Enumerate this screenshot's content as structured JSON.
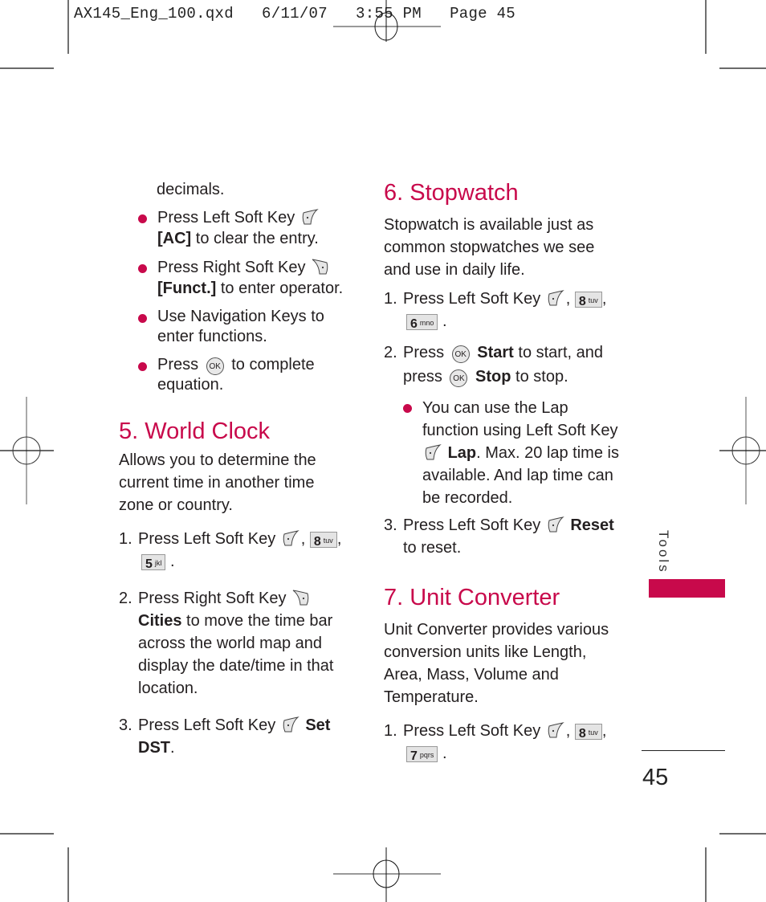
{
  "slug": "AX145_Eng_100.qxd   6/11/07   3:55 PM   Page 45",
  "left_column": {
    "continued_text": "decimals.",
    "bullets": [
      {
        "pre": "Press Left Soft Key",
        "icon": "left-soft-key",
        "bold": "[AC]",
        "post": " to clear the entry."
      },
      {
        "pre": "Press Right Soft Key",
        "icon": "right-soft-key",
        "bold": "[Funct.]",
        "post": " to enter operator."
      },
      {
        "text": "Use Navigation Keys to enter functions."
      },
      {
        "pre": "Press",
        "icon": "ok-key",
        "post": "to complete equation."
      }
    ],
    "section5": {
      "title": "5. World Clock",
      "intro": "Allows you to determine the current time in another time zone or country.",
      "steps": [
        {
          "num": "1.",
          "pre": "Press Left Soft Key",
          "keys": [
            "8",
            "5"
          ],
          "key_letters": [
            "tuv",
            "jkl"
          ]
        },
        {
          "num": "2.",
          "pre": "Press Right Soft Key",
          "bold": "Cities",
          "post": " to move the time bar across the world map and display the date/time in that location."
        },
        {
          "num": "3.",
          "pre": "Press Left Soft Key",
          "bold": "Set DST",
          "post": "."
        }
      ]
    }
  },
  "right_column": {
    "section6": {
      "title": "6. Stopwatch",
      "intro": "Stopwatch is available just as common stopwatches we see and use in daily life.",
      "step1": {
        "num": "1.",
        "pre": "Press Left Soft Key",
        "keys": [
          "8",
          "6"
        ],
        "key_letters": [
          "tuv",
          "mno"
        ]
      },
      "step2": {
        "num": "2.",
        "a": "Press",
        "bold1": "Start",
        "b": " to start, and",
        "c": "press",
        "bold2": "Stop",
        "d": " to stop."
      },
      "bullet": {
        "a": "You can use the Lap function using Left Soft Key",
        "bold": "Lap",
        "b": ". Max. 20 lap time is available. And lap time can be recorded."
      },
      "step3": {
        "num": "3.",
        "pre": "Press Left Soft Key",
        "bold": "Reset",
        "post": "to reset."
      }
    },
    "section7": {
      "title": "7. Unit Converter",
      "intro": "Unit Converter provides various conversion units like Length, Area, Mass, Volume and Temperature.",
      "step1": {
        "num": "1.",
        "pre": "Press Left Soft Key",
        "keys": [
          "8",
          "7"
        ],
        "key_letters": [
          "tuv",
          "pqrs"
        ]
      }
    }
  },
  "ok_label": "OK",
  "side_tab": "Tools",
  "page_number": "45",
  "accent_color": "#c8094b"
}
